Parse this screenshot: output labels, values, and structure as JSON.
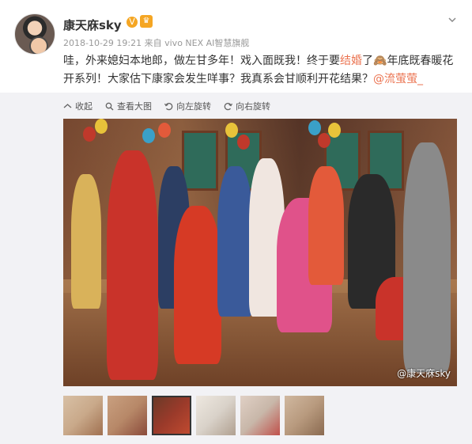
{
  "post": {
    "username": "康天庥sky",
    "timestamp": "2018-10-29 19:21",
    "source": "来自 vivo NEX AI智慧旗舰",
    "text_part1": "哇，外来媳妇本地郎，做左甘多年！戏入面既我！终于要",
    "text_highlight": "结婚",
    "text_part2": "了",
    "text_part3": "年底既春暖花开系列！大家估下康家会发生咩事？我真系会甘顺利开花结果？",
    "mention": "@流萤萤_"
  },
  "toolbar": {
    "collapse": "收起",
    "view_large": "查看大图",
    "rotate_left": "向左旋转",
    "rotate_right": "向右旋转"
  },
  "photo": {
    "watermark": "@康天庥sky"
  },
  "thumbnails": [
    {
      "color": "#c9a98a"
    },
    {
      "color": "#b78868"
    },
    {
      "color": "#9a3a2a",
      "active": true
    },
    {
      "color": "#d9d2c9"
    },
    {
      "color": "#c8b7a9"
    },
    {
      "color": "#b89a7e"
    }
  ],
  "colors": {
    "accent": "#eb7350",
    "verified": "#f5a623"
  }
}
